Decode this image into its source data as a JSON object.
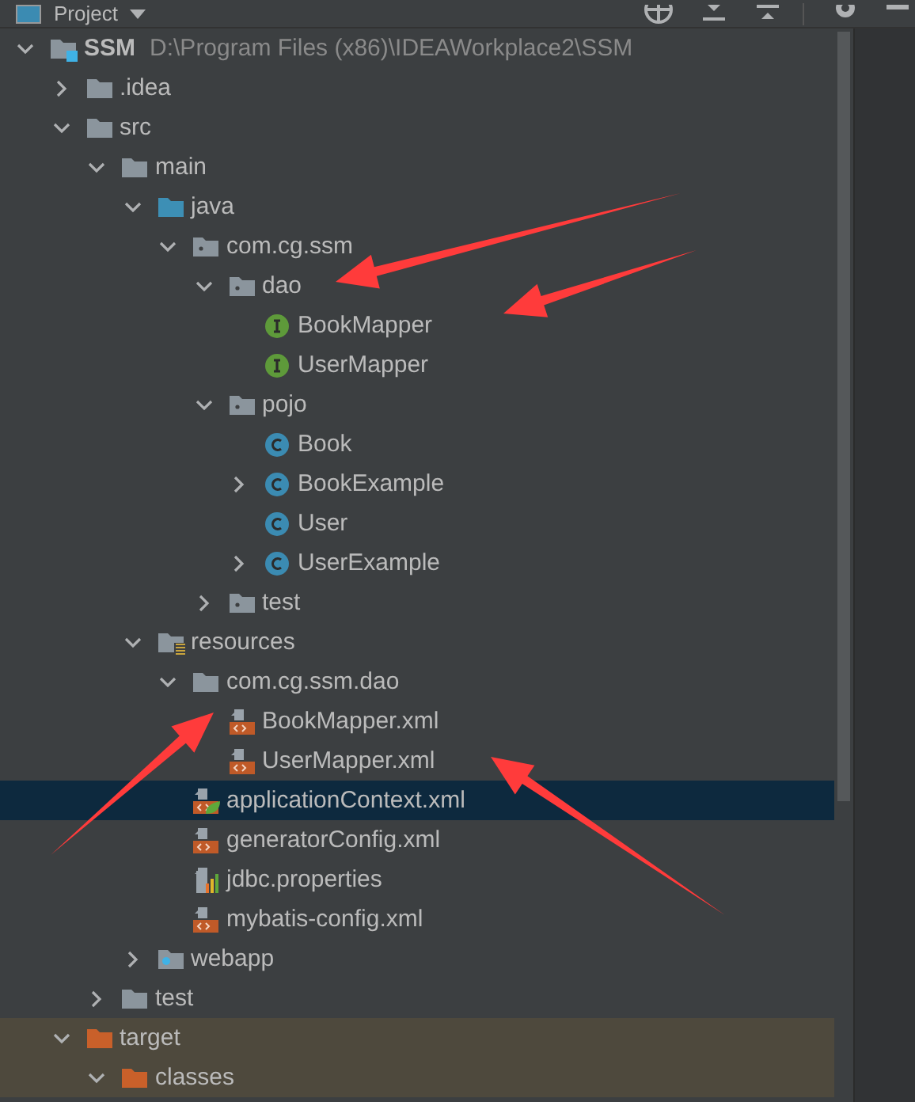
{
  "header": {
    "title": "Project"
  },
  "tree": [
    {
      "label": "SSM",
      "path": "D:\\Program Files (x86)\\IDEAWorkplace2\\SSM",
      "kind": "module",
      "expanded": true,
      "selected": false,
      "children": [
        {
          "label": ".idea",
          "kind": "folder",
          "expanded": false,
          "selected": false
        },
        {
          "label": "src",
          "kind": "folder",
          "expanded": true,
          "selected": false,
          "children": [
            {
              "label": "main",
              "kind": "folder",
              "expanded": true,
              "selected": false,
              "children": [
                {
                  "label": "java",
                  "kind": "source",
                  "expanded": true,
                  "selected": false,
                  "children": [
                    {
                      "label": "com.cg.ssm",
                      "kind": "package",
                      "expanded": true,
                      "selected": false,
                      "children": [
                        {
                          "label": "dao",
                          "kind": "package",
                          "expanded": true,
                          "selected": false,
                          "children": [
                            {
                              "label": "BookMapper",
                              "kind": "interface",
                              "selected": false
                            },
                            {
                              "label": "UserMapper",
                              "kind": "interface",
                              "selected": false
                            }
                          ]
                        },
                        {
                          "label": "pojo",
                          "kind": "package",
                          "expanded": true,
                          "selected": false,
                          "children": [
                            {
                              "label": "Book",
                              "kind": "class",
                              "selected": false
                            },
                            {
                              "label": "BookExample",
                              "kind": "class",
                              "expanded": false,
                              "selected": false
                            },
                            {
                              "label": "User",
                              "kind": "class",
                              "selected": false
                            },
                            {
                              "label": "UserExample",
                              "kind": "class",
                              "expanded": false,
                              "selected": false
                            }
                          ]
                        },
                        {
                          "label": "test",
                          "kind": "package",
                          "expanded": false,
                          "selected": false
                        }
                      ]
                    }
                  ]
                },
                {
                  "label": "resources",
                  "kind": "resources",
                  "expanded": true,
                  "selected": false,
                  "children": [
                    {
                      "label": "com.cg.ssm.dao",
                      "kind": "folder",
                      "expanded": true,
                      "selected": false,
                      "children": [
                        {
                          "label": "BookMapper.xml",
                          "kind": "xml",
                          "selected": false
                        },
                        {
                          "label": "UserMapper.xml",
                          "kind": "xml",
                          "selected": false
                        }
                      ]
                    },
                    {
                      "label": "applicationContext.xml",
                      "kind": "spring",
                      "selected": true
                    },
                    {
                      "label": "generatorConfig.xml",
                      "kind": "xml",
                      "selected": false
                    },
                    {
                      "label": "jdbc.properties",
                      "kind": "properties",
                      "selected": false
                    },
                    {
                      "label": "mybatis-config.xml",
                      "kind": "xml",
                      "selected": false
                    }
                  ]
                },
                {
                  "label": "webapp",
                  "kind": "web",
                  "expanded": false,
                  "selected": false
                }
              ]
            },
            {
              "label": "test",
              "kind": "folder",
              "expanded": false,
              "selected": false
            }
          ]
        },
        {
          "label": "target",
          "kind": "folder",
          "excluded": true,
          "expanded": true,
          "selected": false,
          "children": [
            {
              "label": "classes",
              "kind": "folder",
              "excluded": true,
              "expanded": true,
              "selected": false
            }
          ]
        }
      ]
    }
  ]
}
